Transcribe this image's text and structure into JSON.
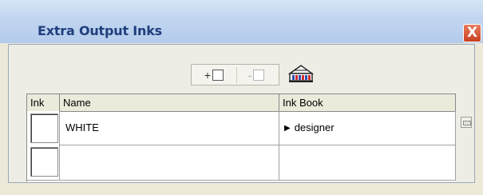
{
  "window": {
    "title": "Extra Output Inks",
    "close_glyph": "X"
  },
  "toolbar": {
    "add_label": "+",
    "remove_label": "-",
    "add_icon": "add-ink-icon",
    "remove_icon": "remove-ink-icon",
    "inkbook_icon": "ink-book-icon"
  },
  "table": {
    "headers": [
      "Ink",
      "Name",
      "Ink Book"
    ],
    "rows": [
      {
        "ink_color": "#ffffff",
        "name": "WHITE",
        "ink_book": "designer",
        "expand_glyph": "▶"
      },
      {
        "ink_color": "#ffffff",
        "name": "",
        "ink_book": "",
        "expand_glyph": ""
      }
    ]
  },
  "colors": {
    "title_text": "#1f3f7c",
    "close_button": "#c8401f",
    "panel_bg": "#eeede5"
  }
}
